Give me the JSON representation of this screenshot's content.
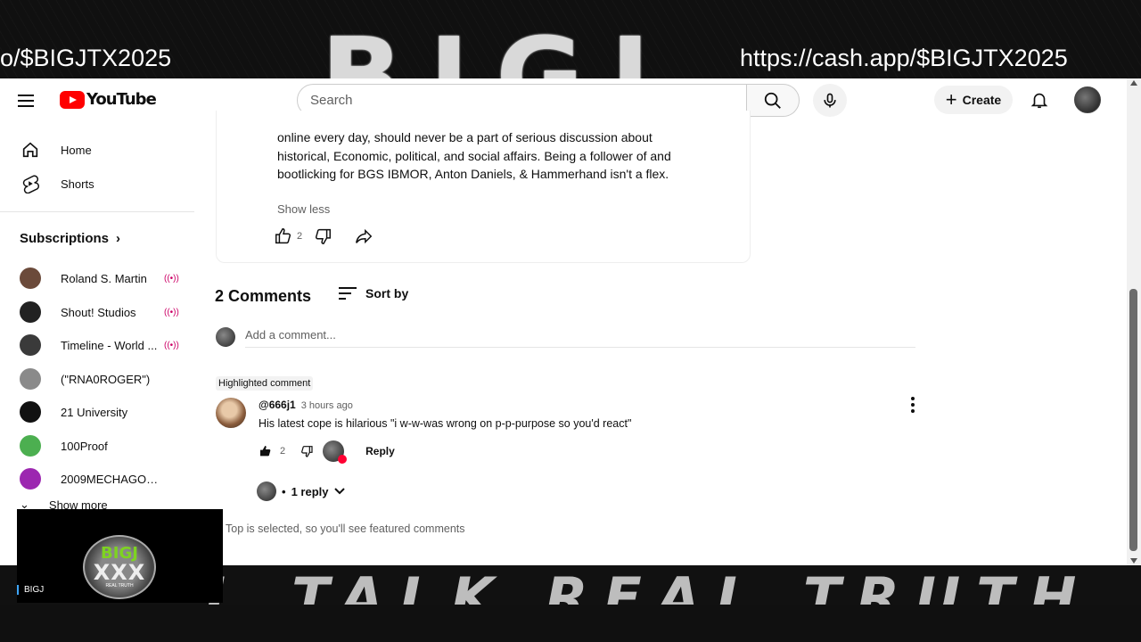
{
  "overlay": {
    "top_text": "BIGJ",
    "bottom_slogan": "L TALK REAL TRUTH",
    "ticker_left": "o/$BIGJTX2025",
    "ticker_right": "https://cash.app/$BIGJTX2025",
    "brand_line1": "BIGJ",
    "brand_line2": "XXX",
    "brand_line3": "REAL TRUTH",
    "brand_tag": "BIGJ"
  },
  "topbar": {
    "logo_text": "YouTube",
    "search_placeholder": "Search",
    "create_label": "Create"
  },
  "sidebar": {
    "home": "Home",
    "shorts": "Shorts",
    "subscriptions_label": "Subscriptions",
    "show_more": "Show more",
    "subs": [
      {
        "name": "Roland S. Martin",
        "live": true,
        "color": "#6b4a3a"
      },
      {
        "name": "Shout! Studios",
        "live": true,
        "color": "#222222"
      },
      {
        "name": "Timeline - World ...",
        "live": true,
        "color": "#3a3a3a"
      },
      {
        "name": "(\"RNA0ROGER\")",
        "live": false,
        "color": "#8a8a8a"
      },
      {
        "name": "21 University",
        "live": false,
        "color": "#111111"
      },
      {
        "name": "100Proof",
        "live": false,
        "color": "#4caf50"
      },
      {
        "name": "2009MECHAGODZI...",
        "live": false,
        "color": "#9c27b0"
      }
    ]
  },
  "description": {
    "text": "online every day, should never be a part of serious discussion about historical, Economic, political, and social affairs. Being a follower of and bootlicking for BGS IBMOR, Anton Daniels, & Hammerhand isn't a flex.",
    "show_less": "Show less",
    "like_count": "2"
  },
  "comments": {
    "header": "2 Comments",
    "sort_label": "Sort by",
    "add_placeholder": "Add a comment...",
    "highlight_tag": "Highlighted comment",
    "author": "@666j1",
    "time": "3 hours ago",
    "text": "His latest cope is hilarious \"i w-w-was wrong on p-p-purpose so you'd react\"",
    "like_count": "2",
    "reply_label": "Reply",
    "replies_label": "1 reply",
    "footer_note": "Top is selected, so you'll see featured comments"
  }
}
